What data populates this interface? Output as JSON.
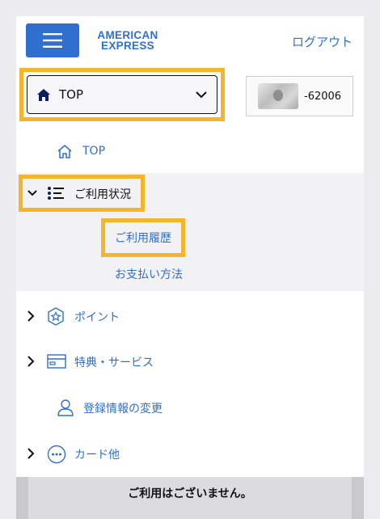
{
  "header": {
    "brand_line1": "AMERICAN",
    "brand_line2": "EXPRESS",
    "logout_label": "ログアウト",
    "brand_color": "#2f6fd0"
  },
  "selector": {
    "current": "TOP",
    "card_suffix": "-62006"
  },
  "nav": {
    "top_label": "TOP",
    "usage_label": "ご利用状況",
    "usage_items": [
      "ご利用履歴",
      "お支払い方法"
    ],
    "points_label": "ポイント",
    "benefits_label": "特典・サービス",
    "profile_label": "登録情報の変更",
    "card_other_label": "カード他"
  },
  "footer": {
    "message": "ご利用はございません。"
  },
  "highlight_color": "#f5b52a",
  "icons": [
    "menu-icon",
    "home-icon",
    "chevron-down-icon",
    "home-outline-icon",
    "list-icon",
    "star-badge-icon",
    "card-icon",
    "user-icon",
    "more-icon",
    "chevron-right-icon"
  ]
}
